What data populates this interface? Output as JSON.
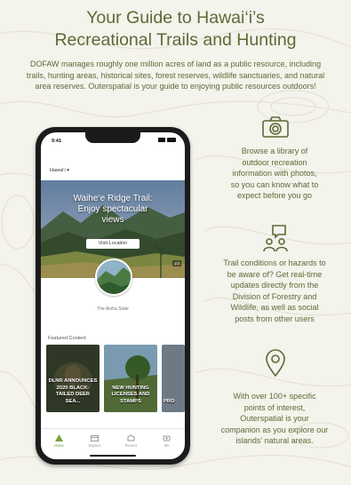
{
  "title_line1": "Your Guide to Hawai‘i’s",
  "title_line2": "Recreational Trails and Hunting",
  "intro": "DOFAW manages roughly one million acres of land as a public resource, including trails, hunting areas, historical sites, forest reserves, wildlife sanctuaries, and natural area reserves. Outerspatial is your guide to enjoying public resources outdoors!",
  "phone": {
    "time": "9:41",
    "region": "Hawai‘i ▾",
    "hero_line1": "Waihe‘e Ridge Trail:",
    "hero_line2": "Enjoy spectacular",
    "hero_line3": "views",
    "hero_button": "Visit Location",
    "hero_count": "1/3",
    "badge_label": "The Aloha State",
    "featured_label": "Featured Content",
    "cards": [
      {
        "title": "DLNR ANNOUNCES 2020 BLACK-TAILED DEER SEA..."
      },
      {
        "title": "NEW HUNTING LICENSES AND STAMPS"
      },
      {
        "title": "PRO"
      }
    ],
    "tabs": [
      {
        "label": "Home",
        "icon": "home-icon"
      },
      {
        "label": "Explore",
        "icon": "explore-icon"
      },
      {
        "label": "Recent",
        "icon": "recent-icon"
      },
      {
        "label": "Me",
        "icon": "me-icon"
      }
    ]
  },
  "features": [
    {
      "icon": "camera-icon",
      "lines": [
        "Browse a library of",
        "outdoor recreation",
        "information with photos,",
        "so you can know what to",
        "expect before you go"
      ]
    },
    {
      "icon": "community-icon",
      "lines": [
        "Trail conditions or hazards to",
        "be aware of? Get real-time",
        "updates directly from the",
        "Division of Forestry and",
        "Wildlife, as well as social",
        "posts from other users"
      ]
    },
    {
      "icon": "map-pin-icon",
      "lines": [
        "With over 100+ specific",
        "points of interest,",
        "Outerspatial is your",
        "companion as you explore our",
        "islands’ natural areas."
      ]
    }
  ],
  "colors": {
    "accent_text": "#5b6b36",
    "tab_active": "#7aa038",
    "background": "#f4f3ec"
  }
}
